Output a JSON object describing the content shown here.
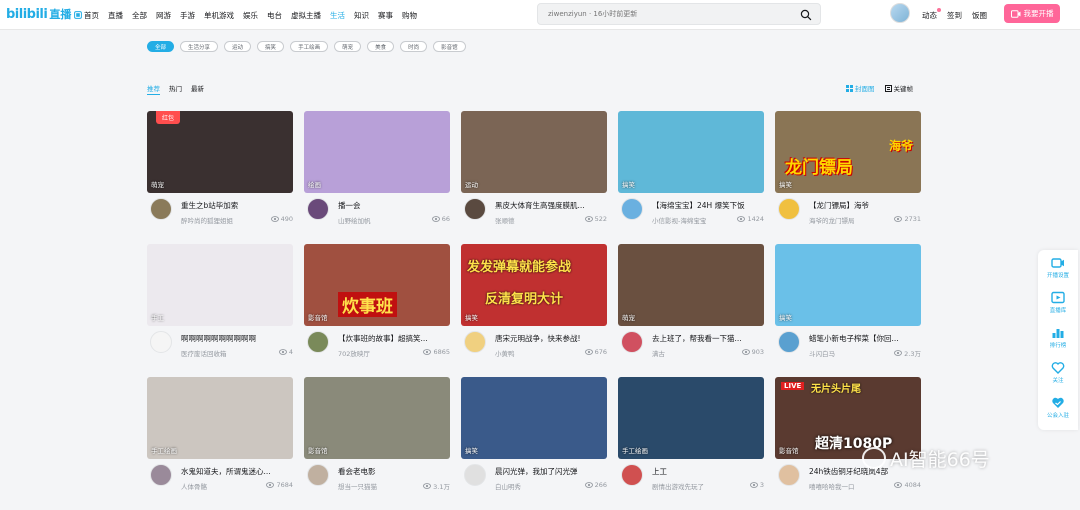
{
  "brand": {
    "logo_text": "bilibili",
    "logo_sub": "直播"
  },
  "nav": [
    {
      "label": "首页",
      "active": false,
      "icon": "home-icon"
    },
    {
      "label": "直播",
      "active": false
    },
    {
      "label": "全部",
      "active": false
    },
    {
      "label": "网游",
      "active": false
    },
    {
      "label": "手游",
      "active": false
    },
    {
      "label": "单机游戏",
      "active": false
    },
    {
      "label": "娱乐",
      "active": false
    },
    {
      "label": "电台",
      "active": false
    },
    {
      "label": "虚拟主播",
      "active": false
    },
    {
      "label": "生活",
      "active": true
    },
    {
      "label": "知识",
      "active": false
    },
    {
      "label": "赛事",
      "active": false
    },
    {
      "label": "购物",
      "active": false
    }
  ],
  "search": {
    "placeholder": "ziwenziyun · 16小时前更新"
  },
  "top_links": [
    "动态",
    "签到",
    "饭圈"
  ],
  "go_live_label": "我要开播",
  "tags": [
    {
      "label": "全部",
      "active": true
    },
    {
      "label": "生活分享",
      "active": false
    },
    {
      "label": "运动",
      "active": false
    },
    {
      "label": "搞笑",
      "active": false
    },
    {
      "label": "手工绘画",
      "active": false
    },
    {
      "label": "萌宠",
      "active": false
    },
    {
      "label": "美食",
      "active": false
    },
    {
      "label": "时尚",
      "active": false
    },
    {
      "label": "影音馆",
      "active": false
    }
  ],
  "sort": [
    {
      "label": "推荐",
      "active": true
    },
    {
      "label": "热门",
      "active": false
    },
    {
      "label": "最新",
      "active": false
    }
  ],
  "view_options": [
    {
      "label": "封面图",
      "active": true,
      "icon": "grid-view-icon"
    },
    {
      "label": "关键帧",
      "active": false,
      "icon": "keyframe-view-icon"
    }
  ],
  "rooms": [
    {
      "title": "重生之b站毕加索",
      "author": "醉吟尚的狐狸姐姐",
      "views": "490",
      "category": "萌宠",
      "badge": "红包",
      "bg": "#3a3030",
      "avatar": "#8a7a5a"
    },
    {
      "title": "播一会",
      "author": "山野绘加帆",
      "views": "66",
      "category": "绘画",
      "bg": "#b8a0d8",
      "avatar": "#6a4a7a"
    },
    {
      "title": "黑皮大体育生高强度膜肌...",
      "author": "张顺德",
      "views": "522",
      "category": "运动",
      "bg": "#7b6555",
      "avatar": "#5a4a40"
    },
    {
      "title": "【海绵宝宝】24H 爆笑下饭",
      "author": "小信影视-海绵宝宝",
      "views": "1424",
      "category": "搞笑",
      "bg": "#5fb8d8",
      "avatar": "#6ab0e0"
    },
    {
      "title": "【龙门镖局】海爷",
      "author": "海爷的龙门镖局",
      "views": "2731",
      "category": "搞笑",
      "bg": "#8a7555",
      "avatar": "#f0c040",
      "overlay": "龙门镖局",
      "overlay2": "海爷"
    },
    {
      "title": "啊啊啊啊啊啊啊啊啊啊",
      "author": "医疗废话回收箱",
      "views": "4",
      "category": "手工",
      "bg": "#ece9ee",
      "avatar": "#f5f5f5"
    },
    {
      "title": "【炊事班的故事】超搞笑...",
      "author": "702放映厅",
      "views": "6865",
      "category": "影音馆",
      "bg": "#a05040",
      "avatar": "#7a8a5a",
      "overlay": "炊事班"
    },
    {
      "title": "唐宋元明战争，快来参战!",
      "author": "小黄鸭",
      "views": "676",
      "category": "搞笑",
      "bg": "#c03030",
      "avatar": "#f0d080",
      "overlay": "发发弹幕就能参战",
      "overlay2": "反清复明大计"
    },
    {
      "title": "去上班了，帮我看一下猫...",
      "author": "满古",
      "views": "903",
      "category": "萌宠",
      "bg": "#6a5040",
      "avatar": "#d05060"
    },
    {
      "title": "蜡笔小新电子榨菜【你回...",
      "author": "斗闪白马",
      "views": "2.3万",
      "category": "搞笑",
      "bg": "#6ac0e8",
      "avatar": "#5aa0d0"
    },
    {
      "title": "水鬼知道夫，所谓鬼迷心...",
      "author": "人体骨骼",
      "views": "7684",
      "category": "手工绘画",
      "bg": "#ccc6c0",
      "avatar": "#9a8a9a"
    },
    {
      "title": "看会老电影",
      "author": "想当一只猫猫",
      "views": "3.1万",
      "category": "影音馆",
      "bg": "#8a8a7a",
      "avatar": "#c0b0a0"
    },
    {
      "title": "晨闪光弹，我加了闪光弹",
      "author": "白山明秀",
      "views": "266",
      "category": "搞笑",
      "bg": "#3a5a8a",
      "avatar": "#e0e0e0"
    },
    {
      "title": "上工",
      "author": "剧情出游戏先玩了",
      "views": "3",
      "category": "手工绘画",
      "bg": "#2a4a6a",
      "avatar": "#d05050"
    },
    {
      "title": "24h铁齿铜牙纪晓岚4部",
      "author": "嘻嘻哈哈我一口",
      "views": "4084",
      "category": "影音馆",
      "bg": "#5a3a30",
      "avatar": "#e0c0a0",
      "overlay": "无片头片尾",
      "overlay2": "超清1080P",
      "live": "LIVE"
    }
  ],
  "side_tools": [
    {
      "label": "开播设置",
      "icon": "camera-icon"
    },
    {
      "label": "直播库",
      "icon": "library-icon"
    },
    {
      "label": "排行榜",
      "icon": "ranking-icon"
    },
    {
      "label": "关注",
      "icon": "follow-icon"
    },
    {
      "label": "公会入驻",
      "icon": "guild-icon"
    }
  ],
  "watermark": "AI智能66号",
  "colors": {
    "accent": "#23ade5",
    "pink": "#ff6699"
  }
}
